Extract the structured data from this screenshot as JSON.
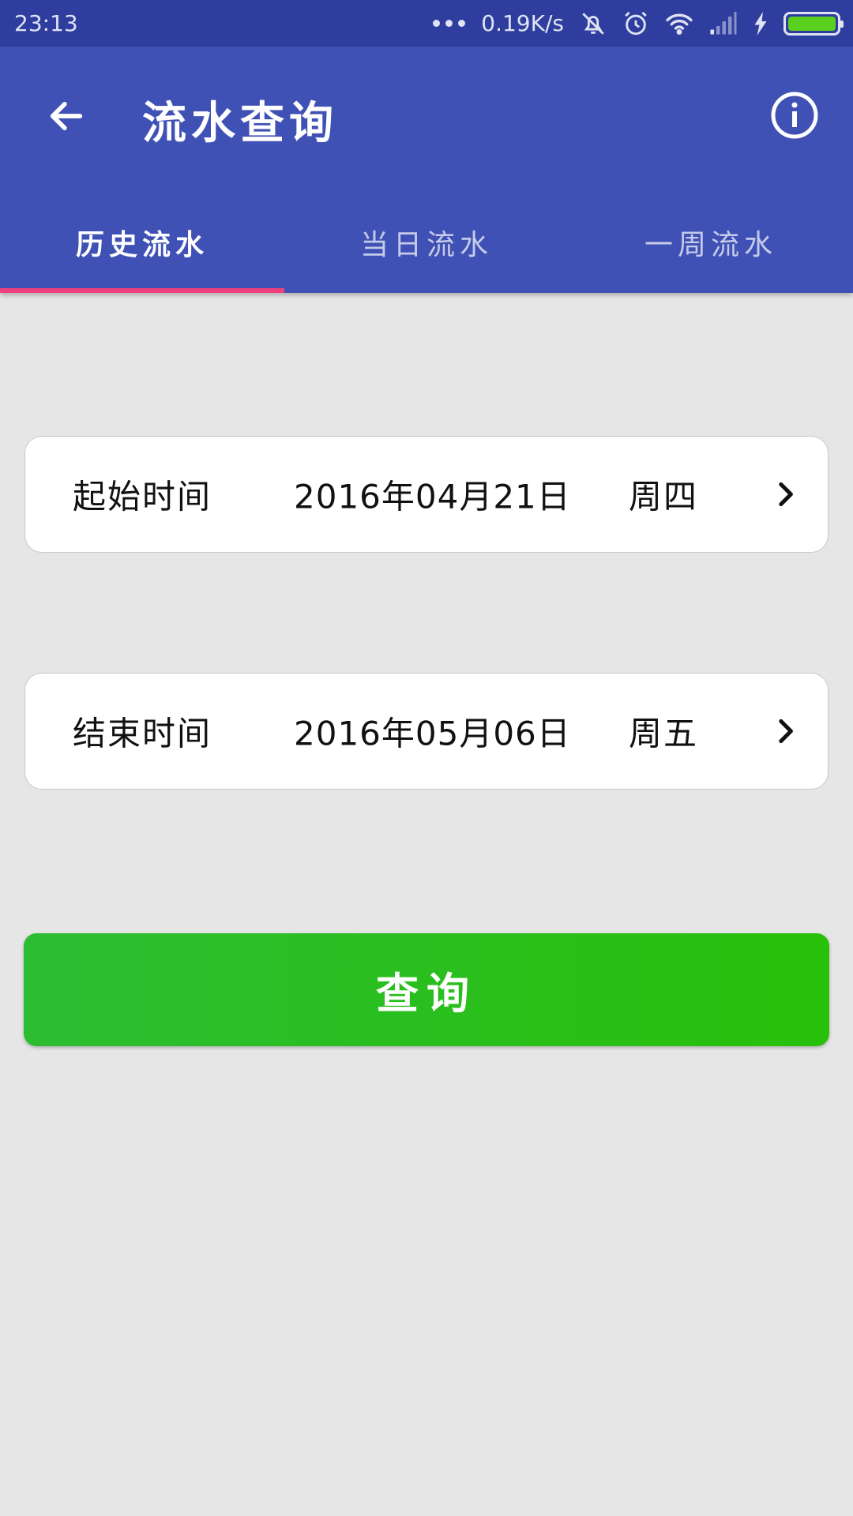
{
  "status_bar": {
    "time": "23:13",
    "net_speed": "0.19K/s",
    "icons": [
      "more-dots-icon",
      "mute-bell-icon",
      "alarm-icon",
      "wifi-icon",
      "signal-icon",
      "charging-bolt-icon",
      "battery-icon"
    ],
    "battery_level": 1.0,
    "background": "#2f3e9e"
  },
  "app_bar": {
    "title": "流水查询",
    "back_icon": "arrow-back-icon",
    "info_icon": "info-icon",
    "background": "#3f51b5"
  },
  "tabs": {
    "items": [
      {
        "label": "历史流水",
        "active": true
      },
      {
        "label": "当日流水",
        "active": false
      },
      {
        "label": "一周流水",
        "active": false
      }
    ],
    "indicator_color": "#f0407c"
  },
  "start": {
    "label": "起始时间",
    "date": "2016年04月21日",
    "weekday": "周四",
    "icon": "chevron-right-icon"
  },
  "end": {
    "label": "结束时间",
    "date": "2016年05月06日",
    "weekday": "周五",
    "icon": "chevron-right-icon"
  },
  "query_button": {
    "label": "查询",
    "color": "#2abf1f"
  }
}
